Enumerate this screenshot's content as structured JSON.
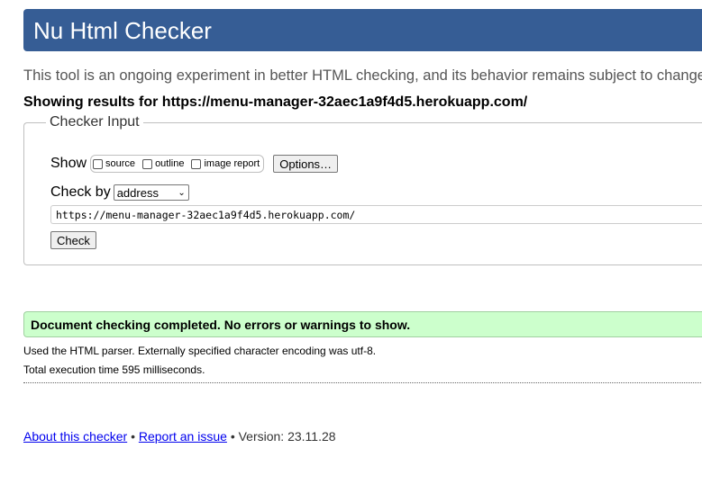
{
  "header": {
    "title": "Nu Html Checker"
  },
  "tagline": "This tool is an ongoing experiment in better HTML checking, and its behavior remains subject to change",
  "showing_results": "Showing results for https://menu-manager-32aec1a9f4d5.herokuapp.com/",
  "checker_input": {
    "legend": "Checker Input",
    "show_label": "Show",
    "show_options": [
      {
        "label": "source",
        "checked": false
      },
      {
        "label": "outline",
        "checked": false
      },
      {
        "label": "image report",
        "checked": false
      }
    ],
    "options_button": "Options…",
    "check_by_label": "Check by",
    "check_by_value": "address",
    "url_value": "https://menu-manager-32aec1a9f4d5.herokuapp.com/",
    "check_button": "Check"
  },
  "result": {
    "message": "Document checking completed. No errors or warnings to show.",
    "color": "#ccffcc"
  },
  "info": {
    "parser": "Used the HTML parser. Externally specified character encoding was utf-8.",
    "execution": "Total execution time 595 milliseconds."
  },
  "footer": {
    "about_link": "About this checker",
    "separator": "•",
    "report_link": "Report an issue",
    "version": "Version: 23.11.28"
  },
  "colors": {
    "header_bg": "#365d95",
    "link": "#0000ee"
  }
}
